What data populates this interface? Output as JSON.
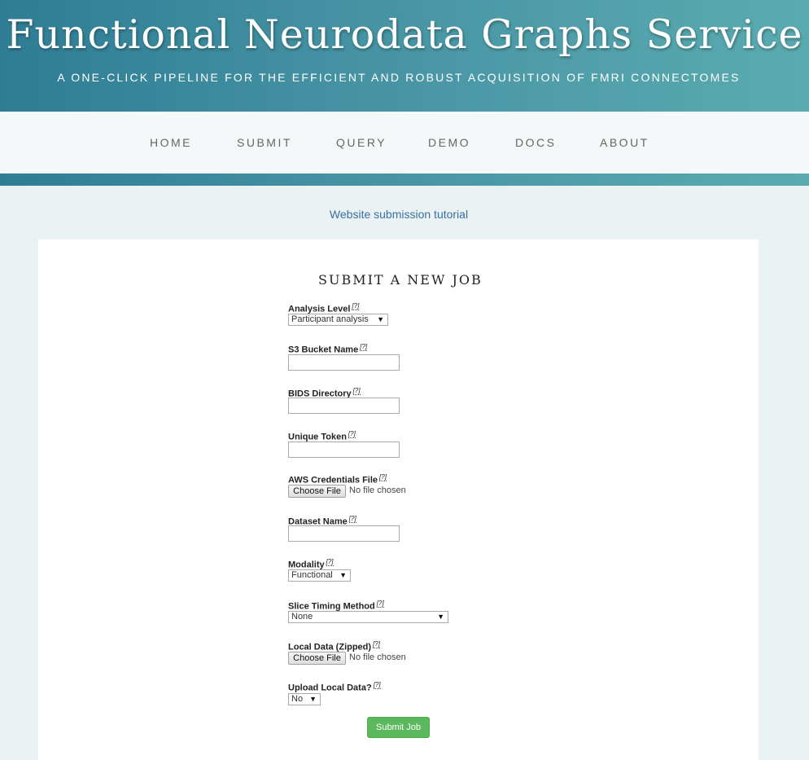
{
  "header": {
    "title": "Functional Neurodata Graphs Service",
    "tagline": "A ONE-CLICK PIPELINE FOR THE EFFICIENT AND ROBUST ACQUISITION OF FMRI CONNECTOMES"
  },
  "nav": {
    "items": [
      {
        "label": "HOME"
      },
      {
        "label": "SUBMIT"
      },
      {
        "label": "QUERY"
      },
      {
        "label": "DEMO"
      },
      {
        "label": "DOCS"
      },
      {
        "label": "ABOUT"
      }
    ]
  },
  "tutorial_link": "Website submission tutorial",
  "form": {
    "title": "SUBMIT A NEW JOB",
    "help_marker": "[?]",
    "fields": {
      "analysis_level": {
        "label": "Analysis Level",
        "value": "Participant analysis"
      },
      "s3_bucket": {
        "label": "S3 Bucket Name",
        "value": ""
      },
      "bids_dir": {
        "label": "BIDS Directory",
        "value": ""
      },
      "token": {
        "label": "Unique Token",
        "value": ""
      },
      "aws_creds": {
        "label": "AWS Credentials File",
        "button": "Choose File",
        "status": "No file chosen"
      },
      "dataset": {
        "label": "Dataset Name",
        "value": ""
      },
      "modality": {
        "label": "Modality",
        "value": "Functional"
      },
      "slice_timing": {
        "label": "Slice Timing Method",
        "value": "None"
      },
      "local_data": {
        "label": "Local Data (Zipped)",
        "button": "Choose File",
        "status": "No file chosen"
      },
      "upload_local": {
        "label": "Upload Local Data?",
        "value": "No"
      }
    },
    "submit_label": "Submit Job"
  },
  "colors": {
    "header_gradient_start": "#2f7d95",
    "header_gradient_end": "#5aabb0",
    "link": "#3a6fa6",
    "submit_button": "#5cb85c"
  }
}
